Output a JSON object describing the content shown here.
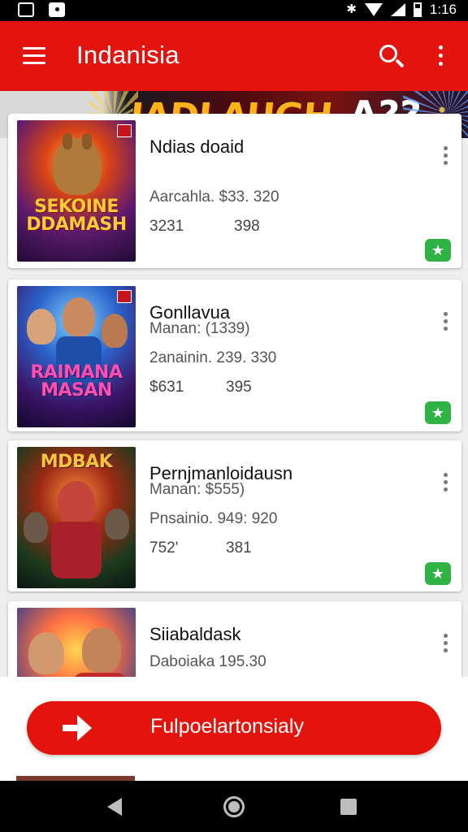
{
  "status_bar": {
    "time": "1:16"
  },
  "app_bar": {
    "title": "Indanisia"
  },
  "promo_banner": {
    "text": "IADLAUGH",
    "tag": "A??"
  },
  "games": [
    {
      "title": "Ndias doaid",
      "line1": "Aarcahla. $33. 320",
      "line2": "",
      "stat_a": "3231",
      "stat_b": "398",
      "thumb_logo": "SEKOINE DDAMASH",
      "show_fav": true
    },
    {
      "title": "Gonllavua",
      "line1": "Manan: (1339)",
      "line2": "2anainin. 239. 330",
      "stat_a": "$631",
      "stat_b": "395",
      "thumb_logo": "RAIMANA MASAN",
      "show_fav": true
    },
    {
      "title": "Pernjmanloidausn",
      "line1": "Manan: $555)",
      "line2": "Pnsainio. 949: 920",
      "stat_a": "752'",
      "stat_b": "381",
      "thumb_logo": "MDBAK",
      "show_fav": true
    },
    {
      "title": "Siiabaldask",
      "line1": "Daboiaka 195.30",
      "line2": "",
      "stat_a": "",
      "stat_b": "",
      "thumb_logo": "",
      "show_fav": false
    }
  ],
  "cta": {
    "label": "Fulpoelartonsialy"
  },
  "colors": {
    "brand_red": "#e2140d",
    "fav_green": "#2fb344"
  }
}
